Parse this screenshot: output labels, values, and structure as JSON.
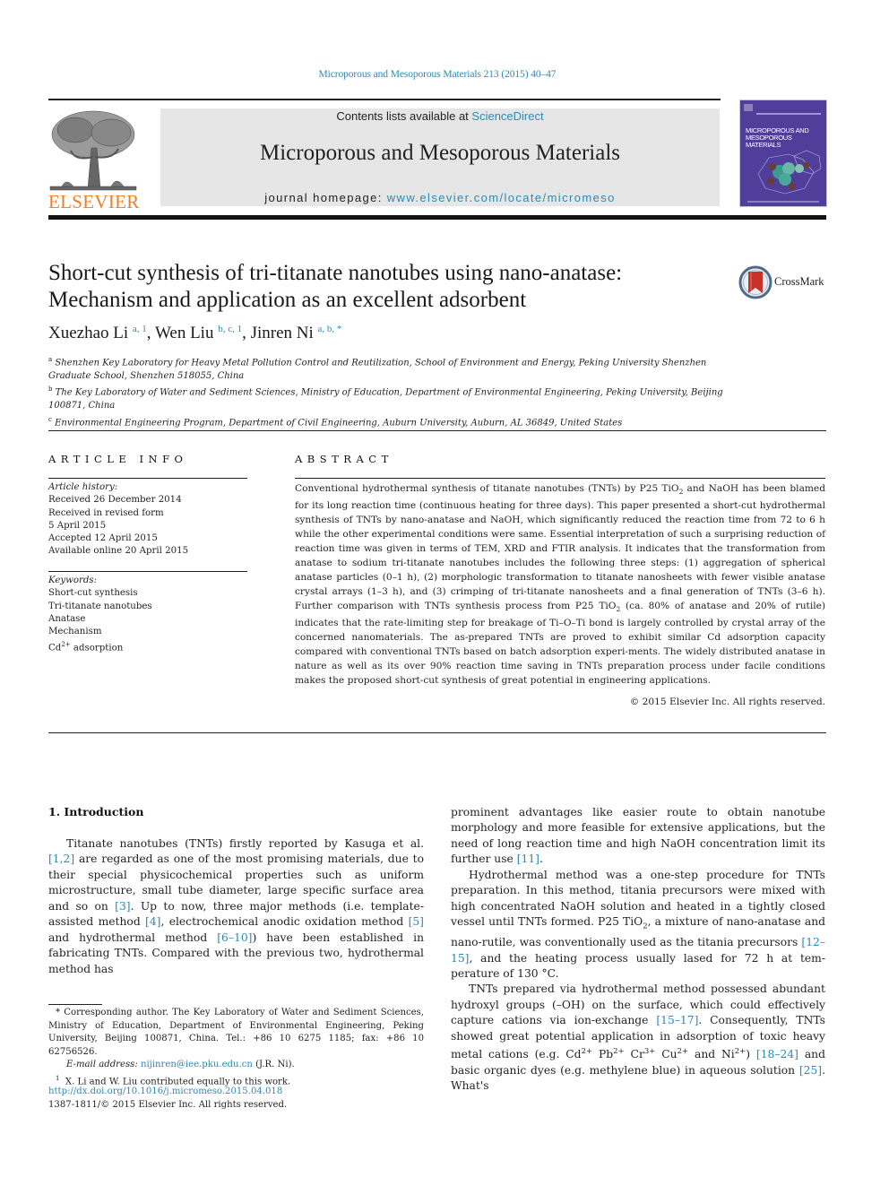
{
  "header": {
    "journal_reference": "Microporous and Mesoporous Materials 213 (2015) 40–47",
    "contents_prefix": "Contents lists available at ",
    "contents_link": "ScienceDirect",
    "journal_title": "Microporous and Mesoporous Materials",
    "homepage_prefix": "journal homepage: ",
    "homepage_link": "www.elsevier.com/locate/micromeso",
    "publisher_name": "ELSEVIER",
    "cover_title_line1": "MICROPOROUS AND",
    "cover_title_line2": "MESOPOROUS MATERIALS",
    "publisher_color": "#f07d24",
    "link_color": "#2a8bb5"
  },
  "article": {
    "title_line1": "Short-cut synthesis of tri-titanate nanotubes using nano-anatase:",
    "title_line2": "Mechanism and application as an excellent adsorbent",
    "crossmark_label": "CrossMark",
    "authors": [
      {
        "name": "Xuezhao Li",
        "marks": "a, 1"
      },
      {
        "name": "Wen Liu",
        "marks": "b, c, 1"
      },
      {
        "name": "Jinren Ni",
        "marks": "a, b, *"
      }
    ],
    "affiliations": [
      {
        "mark": "a",
        "text": "Shenzhen Key Laboratory for Heavy Metal Pollution Control and Reutilization, School of Environment and Energy, Peking University Shenzhen Graduate School, Shenzhen 518055, China"
      },
      {
        "mark": "b",
        "text": "The Key Laboratory of Water and Sediment Sciences, Ministry of Education, Department of Environmental Engineering, Peking University, Beijing 100871, China"
      },
      {
        "mark": "c",
        "text": "Environmental Engineering Program, Department of Civil Engineering, Auburn University, Auburn, AL 36849, United States"
      }
    ]
  },
  "article_info": {
    "heading": "ARTICLE INFO",
    "history_label": "Article history:",
    "history": [
      "Received 26 December 2014",
      "Received in revised form",
      "5 April 2015",
      "Accepted 12 April 2015",
      "Available online 20 April 2015"
    ],
    "keywords_label": "Keywords:",
    "keywords": [
      "Short-cut synthesis",
      "Tri-titanate nanotubes",
      "Anatase",
      "Mechanism"
    ],
    "keyword_last_base": "Cd",
    "keyword_last_sup": "2+",
    "keyword_last_rest": " adsorption"
  },
  "abstract": {
    "heading": "ABSTRACT",
    "part1": "Conventional hydrothermal synthesis of titanate nanotubes (TNTs) by P25 TiO",
    "part2": " and NaOH has been blamed for its long reaction time (continuous heating for three days). This paper presented a short-cut hydrothermal synthesis of TNTs by nano-anatase and NaOH, which significantly reduced the reaction time from 72 to 6 h while the other experimental conditions were same. Essential interpretation of such a surprising reduction of reaction time was given in terms of TEM, XRD and FTIR analysis. It indicates that the transformation from anatase to sodium tri-titanate nanotubes includes the following three steps: (1) aggregation of spherical anatase particles (0–1 h), (2) morphologic transformation to titanate nanosheets with fewer visible anatase crystal arrays (1–3 h), and (3) crimping of tri-titanate nanosheets and a final generation of TNTs (3–6 h). Further comparison with TNTs synthesis process from P25 TiO",
    "part3": " (ca. 80% of anatase and 20% of rutile) indicates that the rate-limiting step for breakage of Ti–O–Ti bond is largely controlled by crystal array of the concerned nanomaterials. The as-prepared TNTs are proved to exhibit similar Cd adsorption capacity compared with conventional TNTs based on batch adsorption experi-ments. The widely distributed anatase in nature as well as its over 90% reaction time saving in TNTs preparation process under facile conditions makes the proposed short-cut synthesis of great potential in engineering applications.",
    "sub2": "2",
    "copyright": "© 2015 Elsevier Inc. All rights reserved."
  },
  "introduction": {
    "heading": "1.  Introduction",
    "left": {
      "p1_a": "Titanate nanotubes (TNTs) firstly reported by Kasuga et al. ",
      "ref1": "[1,2]",
      "p1_b": " are regarded as one of the most promising materials, due to their special physicochemical properties such as uniform microstructure, small tube diameter, large specific surface area and so on ",
      "ref2": "[3]",
      "p1_c": ". Up to now, three major methods (i.e. template-assisted method ",
      "ref3": "[4]",
      "p1_d": ", electrochemical anodic oxidation method ",
      "ref4": "[5]",
      "p1_e": " and hydrothermal method ",
      "ref5": "[6–10]",
      "p1_f": ") have been established in fabricating TNTs. Compared with the previous two, hydrothermal method has"
    },
    "right": {
      "p1_a": "prominent advantages like easier route to obtain nanotube morphology and more feasible for extensive applications, but the need of long reaction time and high NaOH concentration limit its further use ",
      "ref1": "[11]",
      "p1_b": ".",
      "p2_a": "Hydrothermal method was a one-step procedure for TNTs preparation. In this method, titania precursors were mixed with high concentrated NaOH solution and heated in a tightly closed vessel until TNTs formed. P25 TiO",
      "p2_sub": "2",
      "p2_b": ", a mixture of nano-anatase and nano-rutile, was conventionally used as the titania precursors ",
      "ref2": "[12–15]",
      "p2_c": ", and the heating process usually lased for 72 h at tem-perature of 130 °C.",
      "p3_a": "TNTs prepared via hydrothermal method possessed abundant hydroxyl groups (–OH) on the surface, which could effectively capture cations via ion-exchange ",
      "ref3": "[15–17]",
      "p3_b": ". Consequently, TNTs showed great potential application in adsorption of toxic heavy metal cations (e.g. Cd",
      "sup_cd": "2+",
      "pb": " Pb",
      "sup_pb": "2+",
      "cr": " Cr",
      "sup_cr": "3+",
      "cu": " Cu",
      "sup_cu": "2+",
      "ni": " and Ni",
      "sup_ni": "2+",
      "p3_c": ") ",
      "ref4": "[18–24]",
      "p3_d": " and basic organic dyes (e.g. methylene blue) in aqueous solution ",
      "ref5": "[25]",
      "p3_e": ". What's"
    }
  },
  "footnotes": {
    "corresponding": "* Corresponding author. The Key Laboratory of Water and Sediment Sciences, Ministry of Education, Department of Environmental Engineering, Peking University, Beijing 100871, China. Tel.: +86 10 6275 1185; fax: +86 10 62756526.",
    "email_label": "E-mail address: ",
    "email": "nijinren@iee.pku.edu.cn",
    "email_suffix": " (J.R. Ni).",
    "equal_mark": "1",
    "equal": "X. Li and W. Liu contributed equally to this work.",
    "doi": "http://dx.doi.org/10.1016/j.micromeso.2015.04.018",
    "issn": "1387-1811/© 2015 Elsevier Inc. All rights reserved."
  }
}
